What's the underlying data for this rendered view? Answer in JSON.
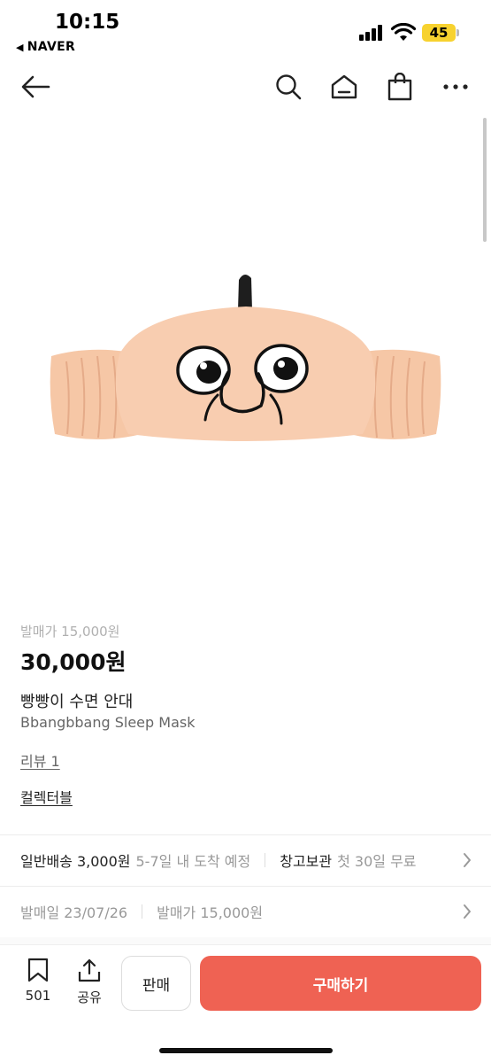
{
  "status": {
    "time": "10:15",
    "back_app": "NAVER",
    "battery": "45"
  },
  "nav": {
    "icons": [
      "back-arrow-icon",
      "search-icon",
      "home-icon",
      "shopping-bag-icon",
      "more-icon"
    ]
  },
  "product": {
    "original_price": "발매가 15,000원",
    "price": "30,000원",
    "name_ko": "빵빵이 수면 안대",
    "name_en": "Bbangbbang Sleep Mask",
    "review": "리뷰 1",
    "category": "컬렉터블"
  },
  "shipping": {
    "label": "일반배송 3,000원",
    "desc": "5-7일 내 도착 예정",
    "storage_label": "창고보관",
    "storage_desc": "첫 30일 무료"
  },
  "release": {
    "date": "발매일 23/07/26",
    "price": "발매가 15,000원"
  },
  "bottom": {
    "bookmark_count": "501",
    "share_label": "공유",
    "sell_label": "판매",
    "buy_label": "구매하기"
  },
  "colors": {
    "buy_button": "#ef6253",
    "mask": "#f8cdb0"
  }
}
